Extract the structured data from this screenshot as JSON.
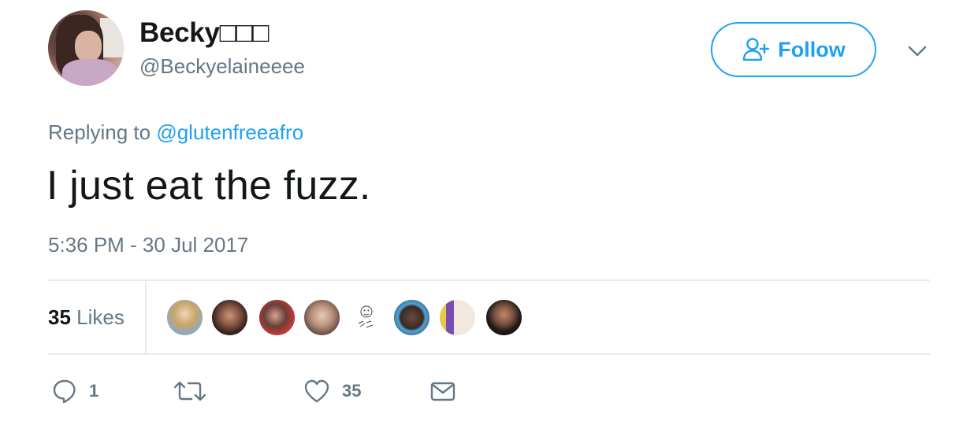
{
  "user": {
    "display_name": "Becky□□□",
    "handle": "@Beckyelaineeee"
  },
  "follow_button": {
    "label": "Follow"
  },
  "reply_context": {
    "prefix": "Replying to",
    "mention": "@glutenfreeafro"
  },
  "tweet": {
    "text": "I just eat the fuzz.",
    "timestamp": "5:36 PM - 30 Jul 2017"
  },
  "stats": {
    "likes_number": "35",
    "likes_label": "Likes"
  },
  "actions": {
    "reply_count": "1",
    "retweet_count": "",
    "like_count": "35"
  },
  "colors": {
    "accent": "#1da1f2",
    "muted": "#657786",
    "text": "#14171a",
    "divider": "#e6ecf0"
  },
  "icons": [
    "person-plus-icon",
    "chevron-down-icon",
    "reply-icon",
    "retweet-icon",
    "heart-icon",
    "envelope-icon"
  ]
}
